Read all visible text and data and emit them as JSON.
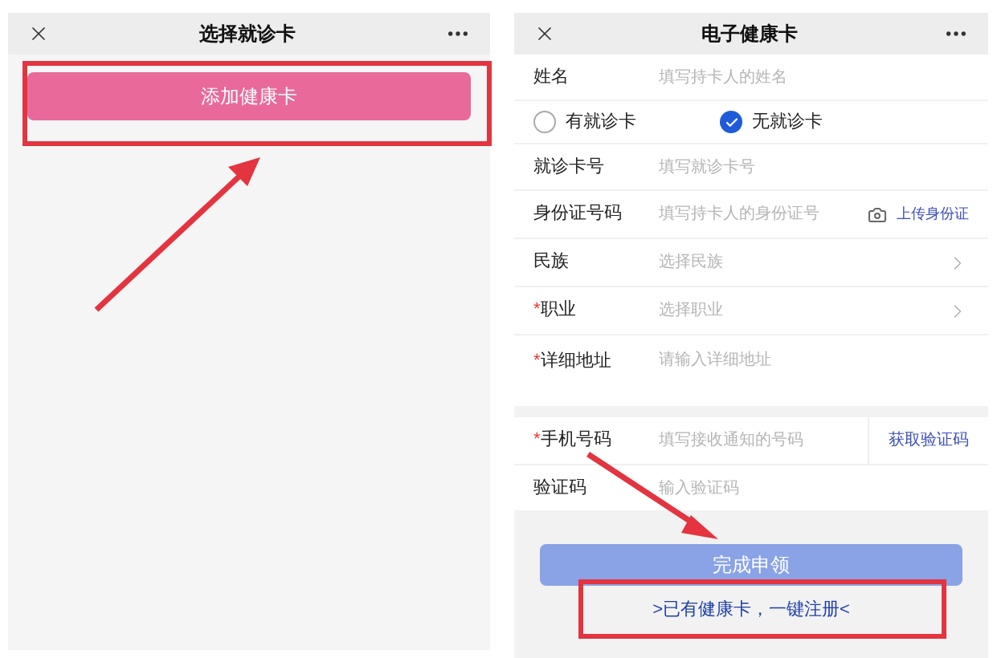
{
  "card_select": {
    "title": "选择就诊卡",
    "add_button": "添加健康卡"
  },
  "health_card": {
    "title": "电子健康卡",
    "rows": [
      {
        "kind": "text",
        "label": "姓名",
        "placeholder": "填写持卡人的姓名"
      },
      {
        "kind": "radios",
        "options": [
          {
            "label": "有就诊卡",
            "selected": false
          },
          {
            "label": "无就诊卡",
            "selected": true
          }
        ]
      },
      {
        "kind": "text",
        "label": "就诊卡号",
        "placeholder": "填写就诊卡号"
      },
      {
        "kind": "upload",
        "label": "身份证号码",
        "placeholder": "填写持卡人的身份证号",
        "action": "上传身份证"
      },
      {
        "kind": "select",
        "label": "民族",
        "placeholder": "选择民族"
      },
      {
        "kind": "select",
        "mark": "*",
        "label": "职业",
        "placeholder": "选择职业"
      },
      {
        "kind": "address",
        "mark": "*",
        "label": "详细地址",
        "placeholder": "请输入详细地址"
      },
      {
        "kind": "sms",
        "mark": "*",
        "label": "手机号码",
        "placeholder": "填写接收通知的号码",
        "action": "获取验证码"
      },
      {
        "kind": "text",
        "label": "验证码",
        "placeholder": "输入验证码"
      }
    ],
    "submit_button": "完成申领",
    "register_link": ">已有健康卡，一键注册<"
  }
}
